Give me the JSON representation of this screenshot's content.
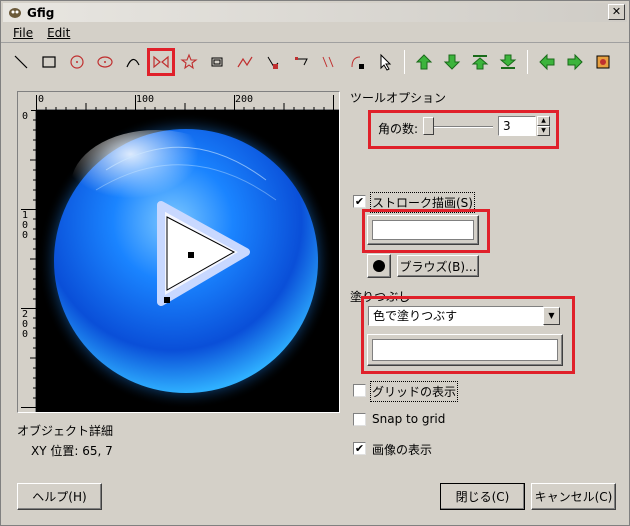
{
  "window": {
    "title": "Gfig",
    "close_glyph": "✕"
  },
  "menu": {
    "items": [
      "File",
      "Edit"
    ]
  },
  "toolbar": {
    "tools": [
      "line",
      "rectangle",
      "circle",
      "ellipse",
      "arc",
      "polygon",
      "star",
      "spiral",
      "bezier",
      "move-object",
      "move-point",
      "copy-object",
      "delete-object",
      "select",
      "raise",
      "lower",
      "top",
      "bottom",
      "back",
      "forward",
      "show-all"
    ],
    "highlighted": "polygon"
  },
  "ruler": {
    "h_labels": [
      "0",
      "100",
      "200"
    ],
    "v_labels": [
      "0",
      "1\n0\n0",
      "2\n0\n0"
    ]
  },
  "tool_options": {
    "title": "ツールオプション",
    "sides_label": "角の数:",
    "sides_value": "3"
  },
  "stroke": {
    "checkbox_label": "ストローク描画(S)",
    "checked_mark": "✔",
    "browse_label": "ブラウズ(B)..."
  },
  "fill": {
    "title": "塗りつぶし",
    "selected_option": "色で塗りつぶす"
  },
  "options": {
    "grid_label": "グリッドの表示",
    "snap_label": "Snap to grid",
    "image_label": "画像の表示",
    "checked_mark": "✔"
  },
  "details": {
    "title": "オブジェクト詳細",
    "xy_label": "XY 位置: 65, 7"
  },
  "buttons": {
    "help": "ヘルプ(H)",
    "close": "閉じる(C)",
    "cancel": "キャンセル(C)"
  },
  "colors": {
    "accent_red": "#e0202a",
    "window_bg": "#d4d0c8",
    "orb_blue": "#0a6cff"
  }
}
